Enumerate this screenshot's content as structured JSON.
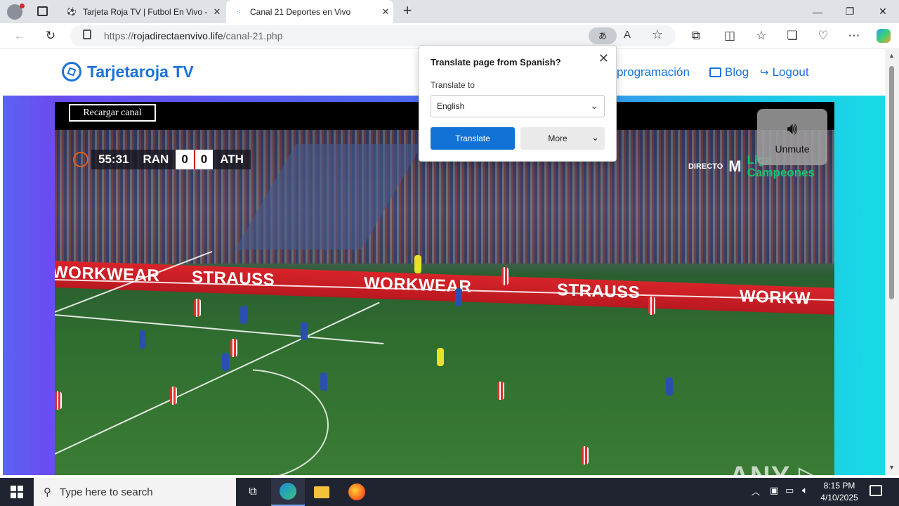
{
  "browser": {
    "tabs": [
      {
        "title": "Tarjeta Roja TV | Futbol En Vivo - Y",
        "close": "✕"
      },
      {
        "title": "Canal 21 Deportes en Vivo",
        "close": "✕"
      }
    ],
    "new_tab": "+",
    "window_controls": {
      "minimize": "—",
      "restore": "❐",
      "close": "✕"
    },
    "url_scheme": "https://",
    "url_host": "rojadirectaenvivo.life",
    "url_path": "/canal-21.php"
  },
  "site": {
    "logo_text": "Tarjetaroja TV",
    "nav": [
      {
        "label": "programación"
      },
      {
        "label": "Blog"
      },
      {
        "label": "Logout"
      }
    ],
    "reload_label": "Recargar canal",
    "unmute_label": "Unmute",
    "watermark": "ANY ▷ RUN"
  },
  "broadcast": {
    "clock": "55:31",
    "home": "RAN",
    "home_score": "0",
    "away_score": "0",
    "away": "ATH",
    "live_label": "DIRECTO",
    "league_line1": "Liga",
    "league_line2": "Campeones",
    "ad_texts": [
      "WORKWEAR",
      "STRAUSS",
      "WORKWEAR",
      "STRAUSS",
      "WORKW"
    ]
  },
  "translate_popup": {
    "title": "Translate page from Spanish?",
    "label": "Translate to",
    "selected_language": "English",
    "translate_button": "Translate",
    "more_button": "More"
  },
  "taskbar": {
    "search_placeholder": "Type here to search",
    "time": "8:15 PM",
    "date": "4/10/2025"
  },
  "colors": {
    "accent_blue": "#1a73d9",
    "translate_button": "#1272d6",
    "ad_red": "#d8242a",
    "league_green": "#14c470"
  }
}
